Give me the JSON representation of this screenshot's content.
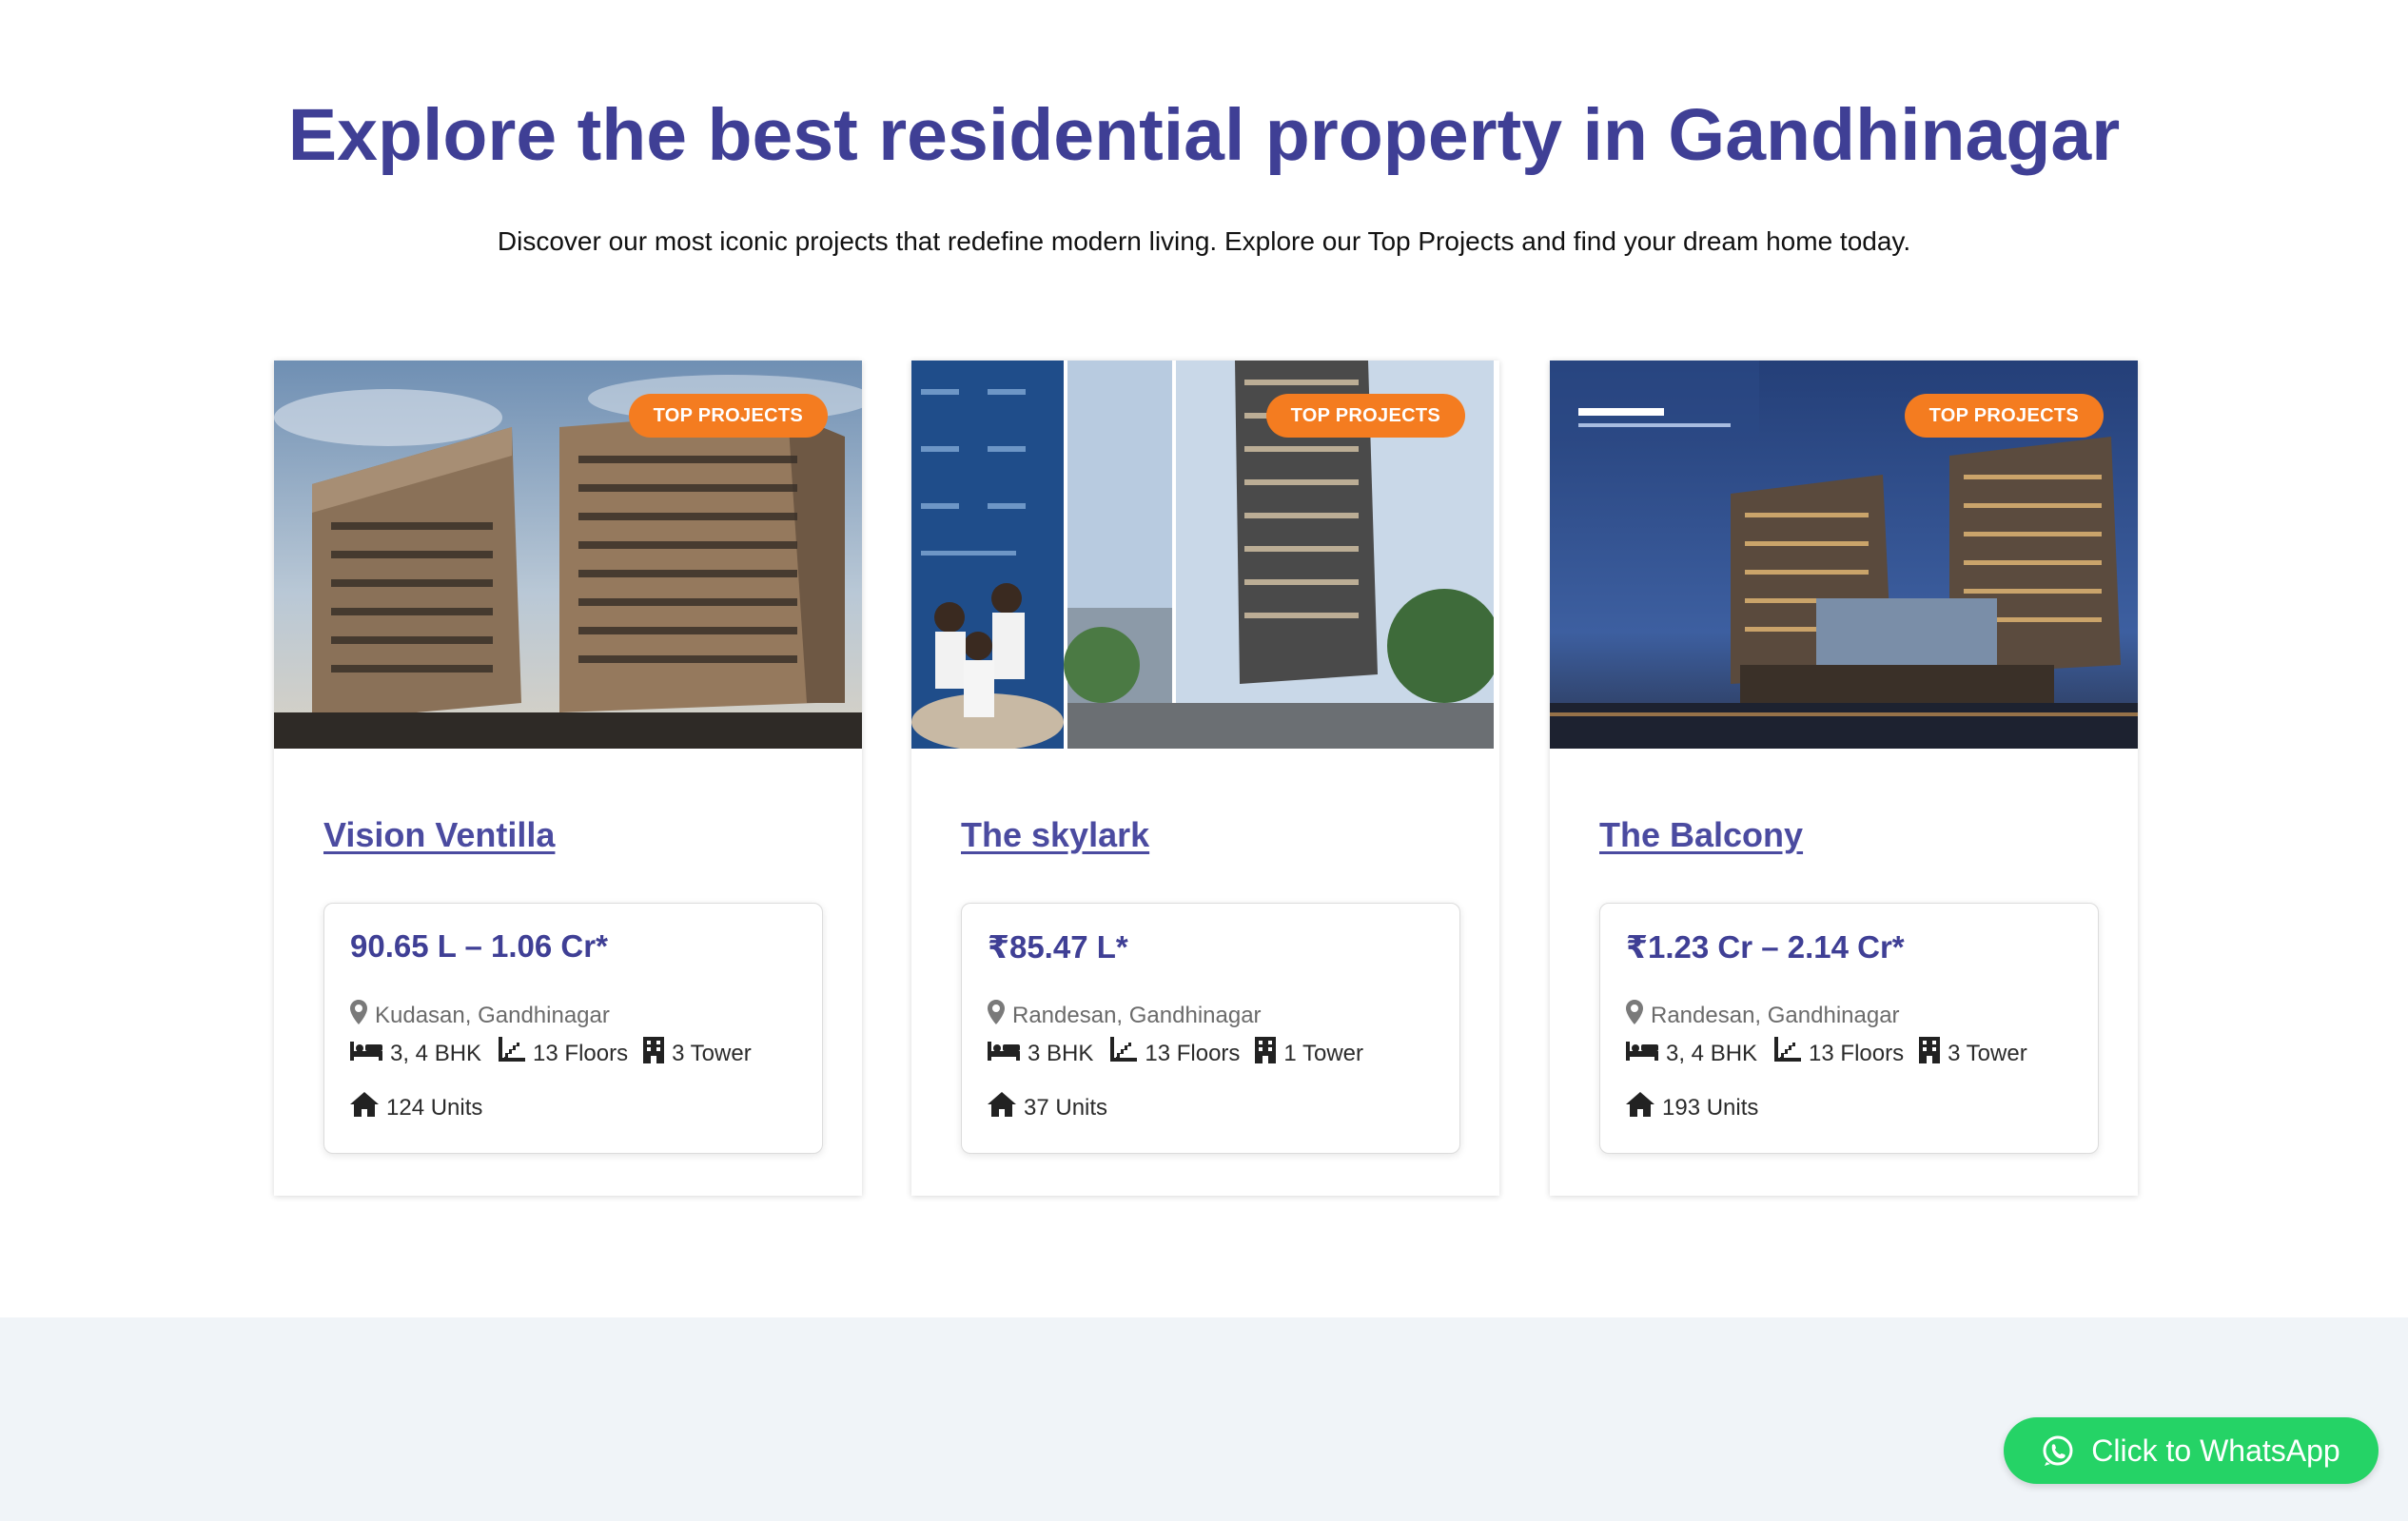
{
  "section": {
    "title": "Explore the best residential property in Gandhinagar",
    "subtitle": "Discover our most iconic projects that redefine modern living. Explore our Top Projects and find your dream home today."
  },
  "cards": [
    {
      "badge": "TOP PROJECTS",
      "title": "Vision Ventilla",
      "price": "90.65 L – 1.06 Cr*",
      "location": "Kudasan, Gandhinagar",
      "bhk": "3, 4 BHK",
      "floors": "13 Floors",
      "towers": "3 Tower",
      "units": "124 Units"
    },
    {
      "badge": "TOP PROJECTS",
      "title": "The skylark",
      "price": "₹85.47 L*",
      "location": "Randesan, Gandhinagar",
      "bhk": "3 BHK",
      "floors": "13 Floors",
      "towers": "1 Tower",
      "units": "37 Units"
    },
    {
      "badge": "TOP PROJECTS",
      "title": "The Balcony",
      "price": "₹1.23 Cr – 2.14 Cr*",
      "location": "Randesan, Gandhinagar",
      "bhk": "3, 4 BHK",
      "floors": "13 Floors",
      "towers": "3 Tower",
      "units": "193 Units"
    }
  ],
  "whatsapp": {
    "label": "Click to WhatsApp"
  },
  "colors": {
    "heading": "#3f3f95",
    "badge": "#f47c20",
    "whatsapp": "#25d366",
    "band": "#f0f4f8"
  }
}
